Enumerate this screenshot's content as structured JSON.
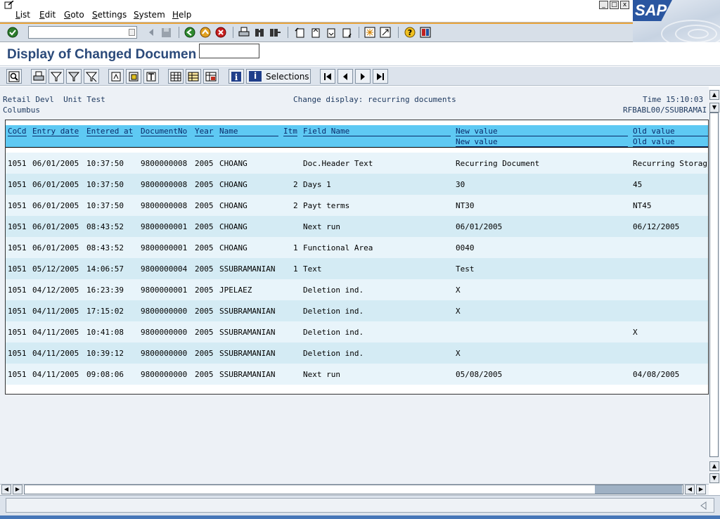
{
  "menu": {
    "items": [
      "List",
      "Edit",
      "Goto",
      "Settings",
      "System",
      "Help"
    ],
    "window_controls": [
      "_",
      "□",
      "x"
    ]
  },
  "logo_text": "SAP",
  "command_field": {
    "value": ""
  },
  "page_title": "Display of Changed Documen",
  "app_toolbar": {
    "selections_label": "Selections"
  },
  "report_header": {
    "left_line1": "Retail Devl  Unit Test",
    "left_line2": "Columbus",
    "center": "Change display: recurring documents",
    "right_line1": "Time 15:10:03",
    "right_line2": "RFBABL00/SSUBRAMAI"
  },
  "columns": {
    "cocd": "CoCd",
    "entry_date": "Entry date",
    "entered_at": "Entered at",
    "document_no": "DocumentNo",
    "year": "Year",
    "name": "Name",
    "itm": "Itm",
    "field_name": "Field Name",
    "new_value": "New value",
    "new_value2": "New value",
    "old_value": "Old value",
    "old_value2": "Old value"
  },
  "rows": [
    {
      "cocd": "1051",
      "date": "06/01/2005",
      "time": "10:37:50",
      "doc": "9800000008",
      "year": "2005",
      "name": "CHOANG",
      "itm": "",
      "field": "Doc.Header Text",
      "new": "Recurring Document",
      "old": "Recurring Storag"
    },
    {
      "cocd": "1051",
      "date": "06/01/2005",
      "time": "10:37:50",
      "doc": "9800000008",
      "year": "2005",
      "name": "CHOANG",
      "itm": "2",
      "field": "Days 1",
      "new": "30",
      "old": "45"
    },
    {
      "cocd": "1051",
      "date": "06/01/2005",
      "time": "10:37:50",
      "doc": "9800000008",
      "year": "2005",
      "name": "CHOANG",
      "itm": "2",
      "field": "Payt terms",
      "new": "NT30",
      "old": "NT45"
    },
    {
      "cocd": "1051",
      "date": "06/01/2005",
      "time": "08:43:52",
      "doc": "9800000001",
      "year": "2005",
      "name": "CHOANG",
      "itm": "",
      "field": "Next run",
      "new": "06/01/2005",
      "old": "06/12/2005"
    },
    {
      "cocd": "1051",
      "date": "06/01/2005",
      "time": "08:43:52",
      "doc": "9800000001",
      "year": "2005",
      "name": "CHOANG",
      "itm": "1",
      "field": "Functional Area",
      "new": "0040",
      "old": ""
    },
    {
      "cocd": "1051",
      "date": "05/12/2005",
      "time": "14:06:57",
      "doc": "9800000004",
      "year": "2005",
      "name": "SSUBRAMANIAN",
      "itm": "1",
      "field": "Text",
      "new": "Test",
      "old": ""
    },
    {
      "cocd": "1051",
      "date": "04/12/2005",
      "time": "16:23:39",
      "doc": "9800000001",
      "year": "2005",
      "name": "JPELAEZ",
      "itm": "",
      "field": "Deletion ind.",
      "new": "X",
      "old": ""
    },
    {
      "cocd": "1051",
      "date": "04/11/2005",
      "time": "17:15:02",
      "doc": "9800000000",
      "year": "2005",
      "name": "SSUBRAMANIAN",
      "itm": "",
      "field": "Deletion ind.",
      "new": "X",
      "old": ""
    },
    {
      "cocd": "1051",
      "date": "04/11/2005",
      "time": "10:41:08",
      "doc": "9800000000",
      "year": "2005",
      "name": "SSUBRAMANIAN",
      "itm": "",
      "field": "Deletion ind.",
      "new": "",
      "old": "X"
    },
    {
      "cocd": "1051",
      "date": "04/11/2005",
      "time": "10:39:12",
      "doc": "9800000000",
      "year": "2005",
      "name": "SSUBRAMANIAN",
      "itm": "",
      "field": "Deletion ind.",
      "new": "X",
      "old": ""
    },
    {
      "cocd": "1051",
      "date": "04/11/2005",
      "time": "09:08:06",
      "doc": "9800000000",
      "year": "2005",
      "name": "SSUBRAMANIAN",
      "itm": "",
      "field": "Next run",
      "new": "05/08/2005",
      "old": "04/08/2005"
    }
  ],
  "status": {
    "text": ""
  }
}
